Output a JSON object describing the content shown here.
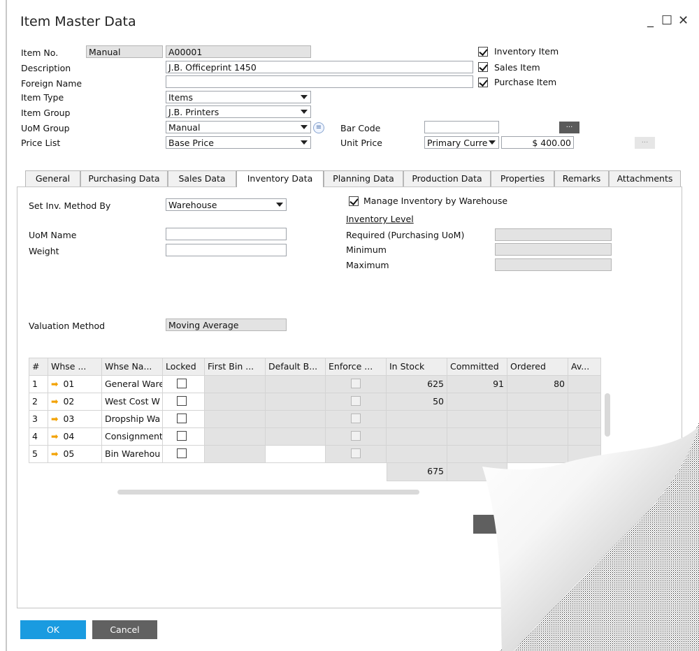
{
  "window": {
    "title": "Item Master Data",
    "minimize": "_",
    "maximize": "☐",
    "close": "✕"
  },
  "header": {
    "item_no_label": "Item No.",
    "item_no_series": "Manual",
    "item_no_value": "A00001",
    "description_label": "Description",
    "description_value": "J.B. Officeprint 1450",
    "foreign_name_label": "Foreign Name",
    "foreign_name_value": "",
    "item_type_label": "Item Type",
    "item_type_value": "Items",
    "item_group_label": "Item Group",
    "item_group_value": "J.B. Printers",
    "uom_group_label": "UoM Group",
    "uom_group_value": "Manual",
    "price_list_label": "Price List",
    "price_list_value": "Base Price",
    "bar_code_label": "Bar Code",
    "bar_code_value": "",
    "unit_price_label": "Unit Price",
    "unit_price_currency": "Primary Curre",
    "unit_price_value": "$ 400.00",
    "ellipsis": "...",
    "inventory_item_label": "Inventory Item",
    "inventory_item_checked": true,
    "sales_item_label": "Sales Item",
    "sales_item_checked": true,
    "purchase_item_label": "Purchase Item",
    "purchase_item_checked": true
  },
  "tabs": [
    "General",
    "Purchasing Data",
    "Sales Data",
    "Inventory Data",
    "Planning Data",
    "Production Data",
    "Properties",
    "Remarks",
    "Attachments"
  ],
  "active_tab": "Inventory Data",
  "inventory": {
    "set_inv_method_label": "Set Inv. Method By",
    "set_inv_method_value": "Warehouse",
    "manage_by_whse_label": "Manage Inventory by Warehouse",
    "manage_by_whse_checked": true,
    "inventory_level_label": "Inventory Level",
    "required_label": "Required (Purchasing UoM)",
    "minimum_label": "Minimum",
    "maximum_label": "Maximum",
    "uom_name_label": "UoM Name",
    "weight_label": "Weight",
    "valuation_method_label": "Valuation Method",
    "valuation_method_value": "Moving Average"
  },
  "grid": {
    "columns": [
      "#",
      "Whse ...",
      "Whse Na...",
      "Locked",
      "First Bin ...",
      "Default B...",
      "Enforce ...",
      "In Stock",
      "Committed",
      "Ordered",
      "Av..."
    ],
    "rows": [
      {
        "n": "1",
        "code": "01",
        "name": "General Ware",
        "in_stock": "625",
        "committed": "91",
        "ordered": "80"
      },
      {
        "n": "2",
        "code": "02",
        "name": "West Cost W",
        "in_stock": "50",
        "committed": "",
        "ordered": ""
      },
      {
        "n": "3",
        "code": "03",
        "name": "Dropship Wa",
        "in_stock": "",
        "committed": "",
        "ordered": ""
      },
      {
        "n": "4",
        "code": "04",
        "name": "Consignment",
        "in_stock": "",
        "committed": "",
        "ordered": ""
      },
      {
        "n": "5",
        "code": "05",
        "name": "Bin Warehou",
        "in_stock": "",
        "committed": "",
        "ordered": ""
      }
    ],
    "total_in_stock": "675",
    "row_arrow": "➡"
  },
  "footer": {
    "ok_label": "OK",
    "cancel_label": "Cancel"
  }
}
